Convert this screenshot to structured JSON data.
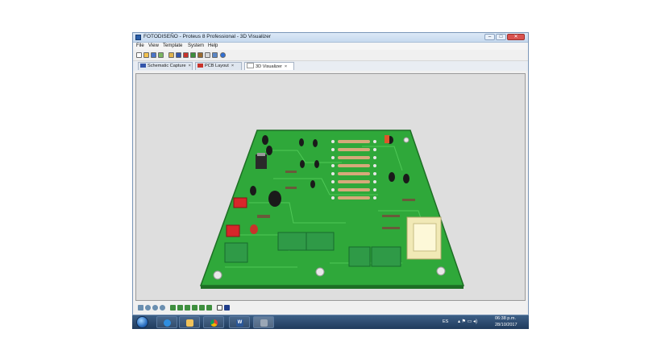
{
  "window": {
    "title": "FOTODISEÑO - Proteus 8 Professional - 3D Visualizer",
    "controls": {
      "minimize": "–",
      "maximize": "□",
      "close": "✕"
    }
  },
  "menu": [
    "File",
    "View",
    "Template",
    "System",
    "Help"
  ],
  "toolbar_icons": [
    "new-file-icon",
    "open-folder-icon",
    "save-icon",
    "import-icon",
    "home-icon",
    "schematic-icon",
    "pcb-icon",
    "3d-icon",
    "gerber-icon",
    "bom-icon",
    "design-explorer-icon",
    "help-icon"
  ],
  "tabs": [
    {
      "label": "Schematic Capture",
      "icon": "schematic-icon",
      "close": "×",
      "active": false
    },
    {
      "label": "PCB Layout",
      "icon": "pcb-icon",
      "close": "×",
      "active": false
    },
    {
      "label": "3D Visualizer",
      "icon": "3d-icon",
      "close": "×",
      "active": true
    }
  ],
  "nav_toolbar_icons": [
    "pan-icon",
    "zoom-in-icon",
    "zoom-out-icon",
    "zoom-extents-icon",
    "view-top-icon",
    "view-front-icon",
    "view-left-icon",
    "view-back-icon",
    "view-right-icon",
    "view-bottom-icon",
    "layers-icon"
  ],
  "taskbar": {
    "apps": [
      "internet-explorer-icon",
      "file-explorer-icon",
      "chrome-icon",
      "word-icon",
      "proteus-icon"
    ],
    "word_glyph": "W",
    "language": "ES",
    "time": "06:38 p.m.",
    "date": "28/10/2017"
  },
  "colors": {
    "board": "#2fa83a",
    "board_edge": "#1d6e24",
    "viewport_bg": "#dedede",
    "taskbar": "#2c4a70"
  }
}
